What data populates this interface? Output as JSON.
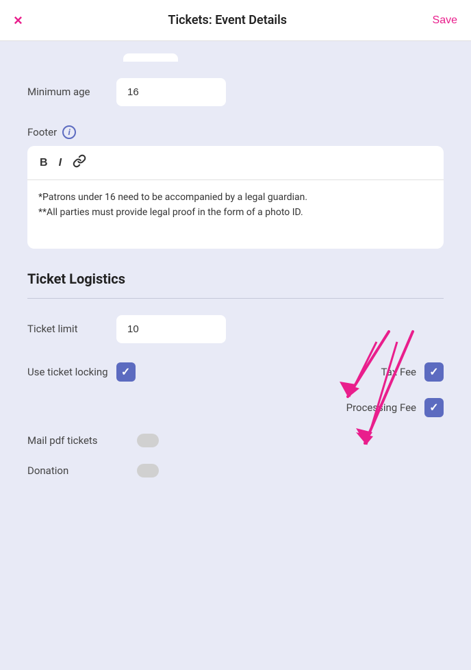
{
  "header": {
    "title": "Tickets: Event Details",
    "close_label": "×",
    "save_label": "Save"
  },
  "minimum_age": {
    "label": "Minimum age",
    "value": "16"
  },
  "footer": {
    "label": "Footer",
    "info_icon": "i",
    "toolbar": {
      "bold": "B",
      "italic": "I",
      "link": "🔗"
    },
    "content_line1": "*Patrons under 16 need to be accompanied by a legal guardian.",
    "content_line2": "**All parties must provide legal proof in the form of a photo ID."
  },
  "ticket_logistics": {
    "heading": "Ticket Logistics",
    "ticket_limit": {
      "label": "Ticket limit",
      "value": "10"
    },
    "use_ticket_locking": {
      "label": "Use ticket locking",
      "checked": true
    },
    "tax_fee": {
      "label": "Tax Fee",
      "checked": true
    },
    "processing_fee": {
      "label": "Processing Fee",
      "checked": true
    },
    "mail_pdf": {
      "label": "Mail pdf tickets",
      "checked": false
    },
    "donation": {
      "label": "Donation",
      "checked": false
    }
  }
}
